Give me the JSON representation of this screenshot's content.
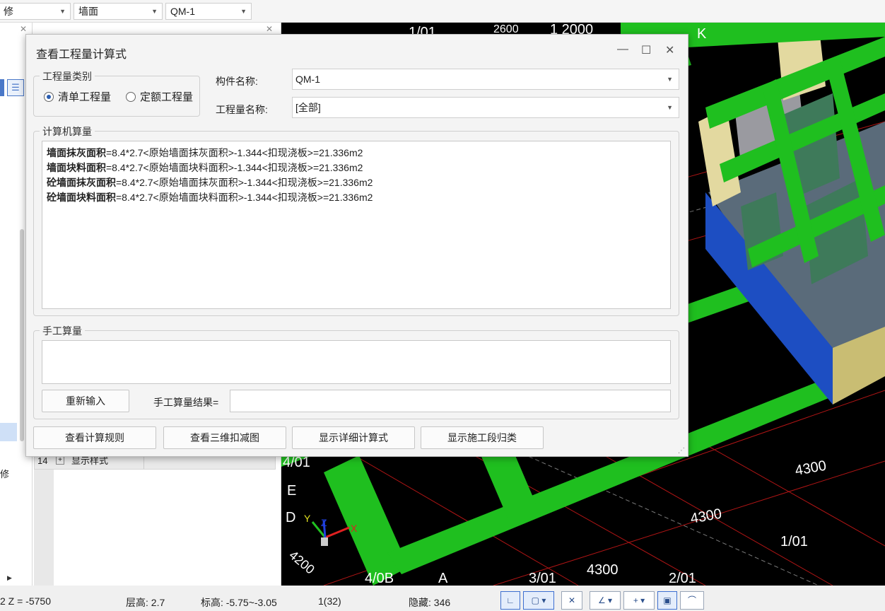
{
  "toolbar": {
    "combo1": "修",
    "combo2": "墙面",
    "combo3": "QM-1"
  },
  "left_panel": {
    "row_num": "14",
    "row_label": "显示样式",
    "side_label": "修"
  },
  "viewport": {
    "labels": {
      "t1": "1/01",
      "t2": "2600",
      "t3": "1 2000",
      "t4": "K",
      "t5": "4/01",
      "e": "E",
      "d": "D",
      "n4200": "4200",
      "b": "4/0B",
      "a": "A",
      "n301": "3/01",
      "n4300a": "4300",
      "n201": "2/01",
      "n4300b": "4300",
      "n4300c": "4300",
      "n101": "1/01",
      "axis_x": "X",
      "axis_y": "Y",
      "axis_z": "Z"
    }
  },
  "dialog": {
    "title": "查看工程量计算式",
    "quantity_type_legend": "工程量类别",
    "radio_bill": "清单工程量",
    "radio_quota": "定额工程量",
    "component_label": "构件名称:",
    "component_value": "QM-1",
    "quantity_name_label": "工程量名称:",
    "quantity_name_value": "[全部]",
    "computer_legend": "计算机算量",
    "calc_lines": [
      {
        "name": "墙面抹灰面积",
        "formula": "=8.4*2.7<原始墙面抹灰面积>-1.344<扣现浇板>=21.336m2"
      },
      {
        "name": "墙面块料面积",
        "formula": "=8.4*2.7<原始墙面块料面积>-1.344<扣现浇板>=21.336m2"
      },
      {
        "name": "砼墙面抹灰面积",
        "formula": "=8.4*2.7<原始墙面抹灰面积>-1.344<扣现浇板>=21.336m2"
      },
      {
        "name": "砼墙面块料面积",
        "formula": "=8.4*2.7<原始墙面块料面积>-1.344<扣现浇板>=21.336m2"
      }
    ],
    "manual_legend": "手工算量",
    "reenter_button": "重新输入",
    "manual_result_label": "手工算量结果=",
    "btn_rules": "查看计算规则",
    "btn_3d": "查看三维扣减图",
    "btn_detail": "显示详细计算式",
    "btn_stage": "显示施工段归类"
  },
  "statusbar": {
    "coord": "2 Z = -5750",
    "floor_height": "层高:  2.7",
    "elevation": "标高:  -5.75~-3.05",
    "count": "1(32)",
    "hidden": "隐藏: 346"
  }
}
